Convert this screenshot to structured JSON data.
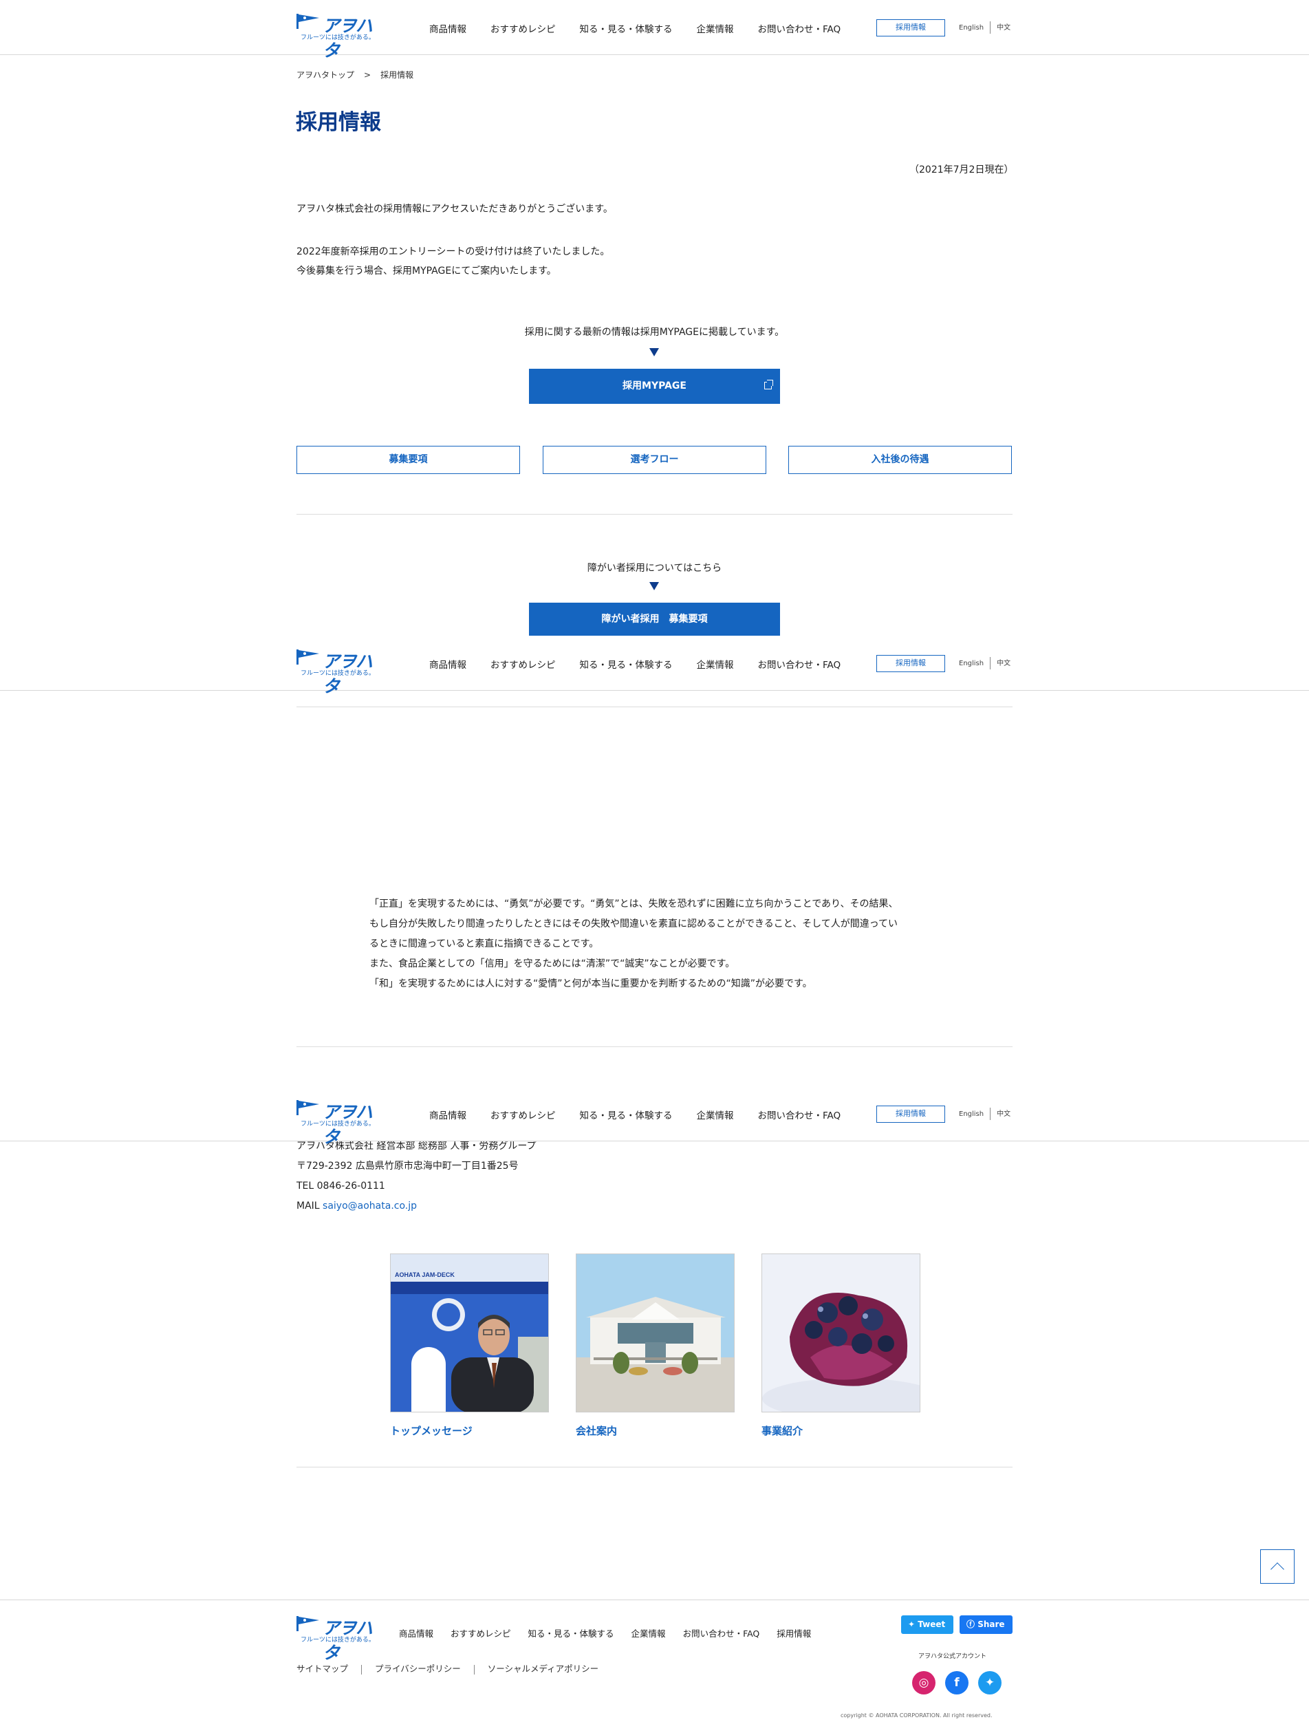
{
  "header": {
    "logo_name": "アヲハタ",
    "logo_tagline": "フルーツには技きがある。",
    "nav": [
      "商品情報",
      "おすすめレシピ",
      "知る・見る・体験する",
      "企業情報",
      "お問い合わせ・FAQ"
    ],
    "recruit": "採用情報",
    "lang_en": "English",
    "lang_zh": "中文"
  },
  "breadcrumb": {
    "top": "アヲハタトップ",
    "sep": ">",
    "current": "採用情報"
  },
  "page_title": "採用情報",
  "as_of": "（2021年7月2日現在）",
  "intro": {
    "thanks": "アヲハタ株式会社の採用情報にアクセスいただきありがとうございます。",
    "closed": "2022年度新卒採用のエントリーシートの受け付けは終了いたしました。",
    "future": "今後募集を行う場合、採用MYPAGEにてご案内いたします。"
  },
  "mypage": {
    "note": "採用に関する最新の情報は採用MYPAGEに掲載しています。",
    "button": "採用MYPAGE"
  },
  "links": [
    "募集要項",
    "選考フロー",
    "入社後の待遇"
  ],
  "disability": {
    "note": "障がい者採用についてはこちら",
    "button": "障がい者採用　募集要項"
  },
  "mission": {
    "line1": "「正直」を実現するためには、“勇気”が必要です。“勇気”とは、失敗を恐れずに困難に立ち向かうことであり、その結果、",
    "line2": "もし自分が失敗したり間違ったりしたときにはその失敗や間違いを素直に認めることができること、そして人が間違ってい",
    "line3": "るときに間違っていると素直に指摘できることです。",
    "line4": "また、食品企業としての「信用」を守るためには“清潔”で“誠実”なことが必要です。",
    "line5": "「和」を実現するためには人に対する“愛情”と何が本当に重要かを判断するための“知識”が必要です。"
  },
  "contact": {
    "dept": "アヲハタ株式会社 経営本部 総務部 人事・労務グループ",
    "address": "〒729-2392 広島県竹原市忠海中町一丁目1番25号",
    "tel": "TEL 0846-26-0111",
    "mail_label": "MAIL ",
    "mail": "saiyo@aohata.co.jp"
  },
  "cards": [
    {
      "label": "トップメッセージ",
      "sign": "AOHATA JAM-DECK"
    },
    {
      "label": "会社案内"
    },
    {
      "label": "事業紹介"
    }
  ],
  "footer": {
    "nav": [
      "商品情報",
      "おすすめレシピ",
      "知る・見る・体験する",
      "企業情報",
      "お問い合わせ・FAQ",
      "採用情報"
    ],
    "sub": [
      "サイトマップ",
      "プライバシーポリシー",
      "ソーシャルメディアポリシー"
    ],
    "tweet": "Tweet",
    "share": "Share",
    "official_accounts": "アヲハタ公式アカウント",
    "copyright": "copyright © AOHATA CORPORATION. All right reserved."
  },
  "colors": {
    "accent": "#1565c0",
    "title": "#0d3c8c",
    "twitter": "#1d9bf0",
    "facebook": "#1877f2",
    "instagram": "#d6246e"
  }
}
